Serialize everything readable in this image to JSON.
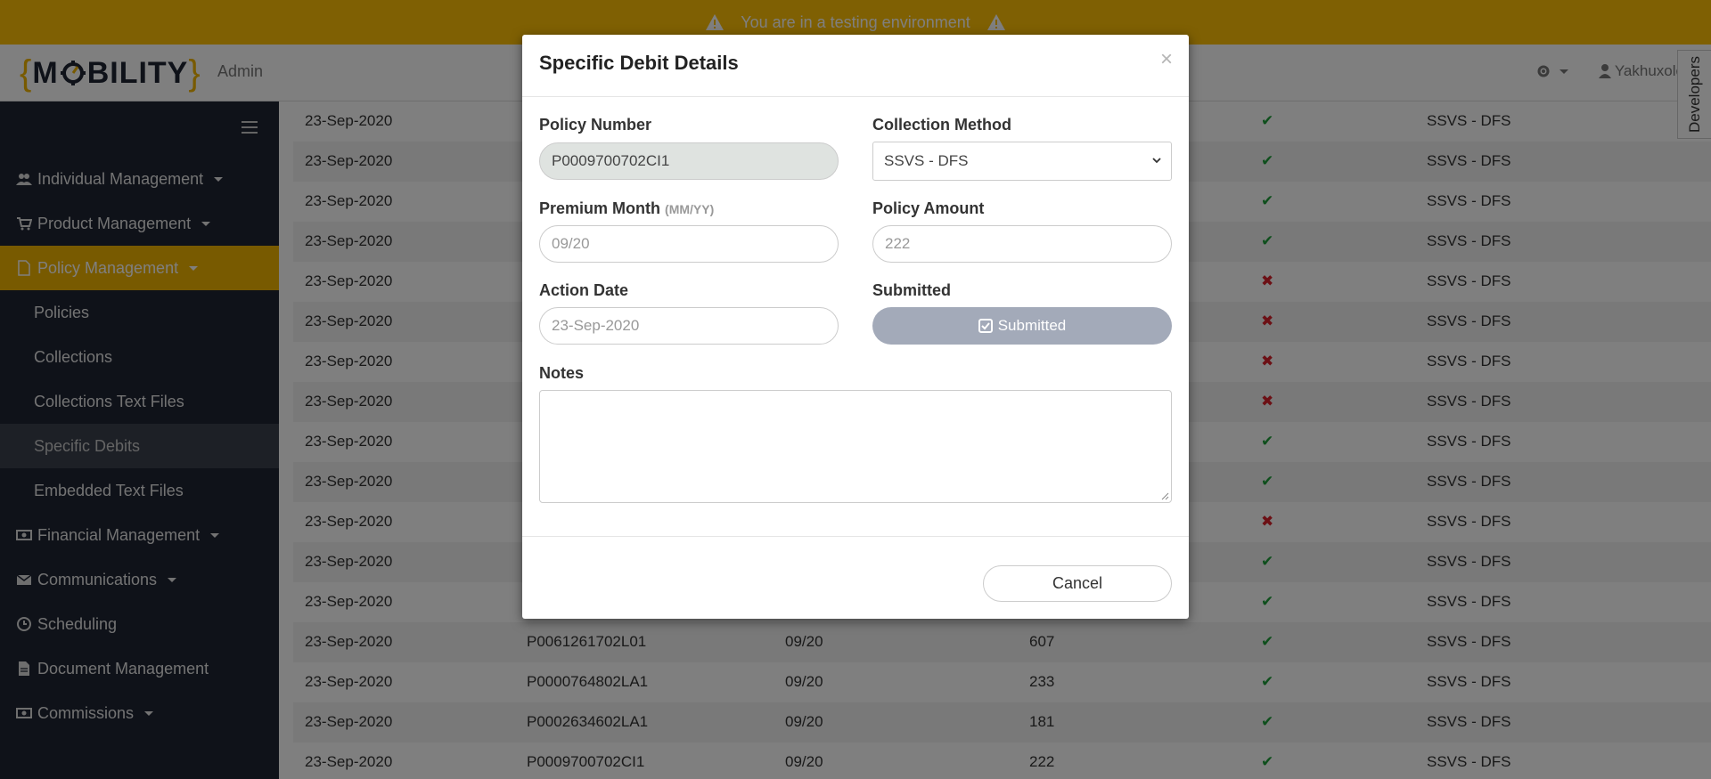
{
  "banner": {
    "text": "You are in a testing environment"
  },
  "navbar": {
    "logo_open": "{",
    "logo_m": "M",
    "logo_rest": "BILITY",
    "logo_close": "}",
    "role": "Admin",
    "user": "Yakhuxolo",
    "settings_icon": "gear-icon",
    "user_icon": "user-icon"
  },
  "developers_tab": "Developers",
  "sidebar": {
    "items": [
      {
        "label": "Individual Management",
        "icon": "users-icon",
        "caret": true
      },
      {
        "label": "Product Management",
        "icon": "cart-icon",
        "caret": true
      },
      {
        "label": "Policy Management",
        "icon": "file-icon",
        "caret": true,
        "active": true
      },
      {
        "label": "Policies",
        "sub": true
      },
      {
        "label": "Collections",
        "sub": true
      },
      {
        "label": "Collections Text Files",
        "sub": true
      },
      {
        "label": "Specific Debits",
        "sub": true,
        "selected": true
      },
      {
        "label": "Embedded Text Files",
        "sub": true
      },
      {
        "label": "Financial Management",
        "icon": "money-icon",
        "caret": true
      },
      {
        "label": "Communications",
        "icon": "envelope-icon",
        "caret": true
      },
      {
        "label": "Scheduling",
        "icon": "clock-icon"
      },
      {
        "label": "Document Management",
        "icon": "document-icon"
      },
      {
        "label": "Commissions",
        "icon": "money-icon",
        "caret": true
      }
    ]
  },
  "table": {
    "rows": [
      {
        "date": "23-Sep-2020",
        "policy": "",
        "month": "",
        "amount": "",
        "submitted": true,
        "method": "SSVS - DFS"
      },
      {
        "date": "23-Sep-2020",
        "policy": "",
        "month": "",
        "amount": "",
        "submitted": true,
        "method": "SSVS - DFS"
      },
      {
        "date": "23-Sep-2020",
        "policy": "",
        "month": "",
        "amount": "",
        "submitted": true,
        "method": "SSVS - DFS"
      },
      {
        "date": "23-Sep-2020",
        "policy": "",
        "month": "",
        "amount": "",
        "submitted": true,
        "method": "SSVS - DFS"
      },
      {
        "date": "23-Sep-2020",
        "policy": "",
        "month": "",
        "amount": "",
        "submitted": false,
        "method": "SSVS - DFS"
      },
      {
        "date": "23-Sep-2020",
        "policy": "",
        "month": "",
        "amount": "",
        "submitted": false,
        "method": "SSVS - DFS"
      },
      {
        "date": "23-Sep-2020",
        "policy": "",
        "month": "",
        "amount": "",
        "submitted": false,
        "method": "SSVS - DFS"
      },
      {
        "date": "23-Sep-2020",
        "policy": "",
        "month": "",
        "amount": "",
        "submitted": false,
        "method": "SSVS - DFS"
      },
      {
        "date": "23-Sep-2020",
        "policy": "",
        "month": "",
        "amount": "",
        "submitted": true,
        "method": "SSVS - DFS"
      },
      {
        "date": "23-Sep-2020",
        "policy": "",
        "month": "",
        "amount": "",
        "submitted": true,
        "method": "SSVS - DFS"
      },
      {
        "date": "23-Sep-2020",
        "policy": "",
        "month": "",
        "amount": "",
        "submitted": false,
        "method": "SSVS - DFS"
      },
      {
        "date": "23-Sep-2020",
        "policy": "",
        "month": "",
        "amount": "",
        "submitted": true,
        "method": "SSVS - DFS"
      },
      {
        "date": "23-Sep-2020",
        "policy": "",
        "month": "",
        "amount": "",
        "submitted": true,
        "method": "SSVS - DFS"
      },
      {
        "date": "23-Sep-2020",
        "policy": "P0061261702L01",
        "month": "09/20",
        "amount": "607",
        "submitted": true,
        "method": "SSVS - DFS"
      },
      {
        "date": "23-Sep-2020",
        "policy": "P0000764802LA1",
        "month": "09/20",
        "amount": "233",
        "submitted": true,
        "method": "SSVS - DFS"
      },
      {
        "date": "23-Sep-2020",
        "policy": "P0002634602LA1",
        "month": "09/20",
        "amount": "181",
        "submitted": true,
        "method": "SSVS - DFS"
      },
      {
        "date": "23-Sep-2020",
        "policy": "P0009700702CI1",
        "month": "09/20",
        "amount": "222",
        "submitted": true,
        "method": "SSVS - DFS"
      }
    ],
    "check_glyph": "✔",
    "cross_glyph": "✖"
  },
  "modal": {
    "title": "Specific Debit Details",
    "close": "×",
    "policy_number_label": "Policy Number",
    "policy_number_value": "P0009700702CI1",
    "collection_method_label": "Collection Method",
    "collection_method_value": "SSVS - DFS",
    "premium_month_label": "Premium Month",
    "premium_month_hint": "(MM/YY)",
    "premium_month_placeholder": "09/20",
    "policy_amount_label": "Policy Amount",
    "policy_amount_placeholder": "222",
    "action_date_label": "Action Date",
    "action_date_placeholder": "23-Sep-2020",
    "submitted_label": "Submitted",
    "submitted_button": "Submitted",
    "notes_label": "Notes",
    "notes_value": "",
    "cancel_button": "Cancel"
  },
  "colors": {
    "banner": "#ffc107",
    "sidebar": "#1e2433",
    "accent": "#f0b400",
    "check": "#1e9e3a",
    "cross": "#d9202a",
    "submitted_button": "#a3aab9"
  }
}
